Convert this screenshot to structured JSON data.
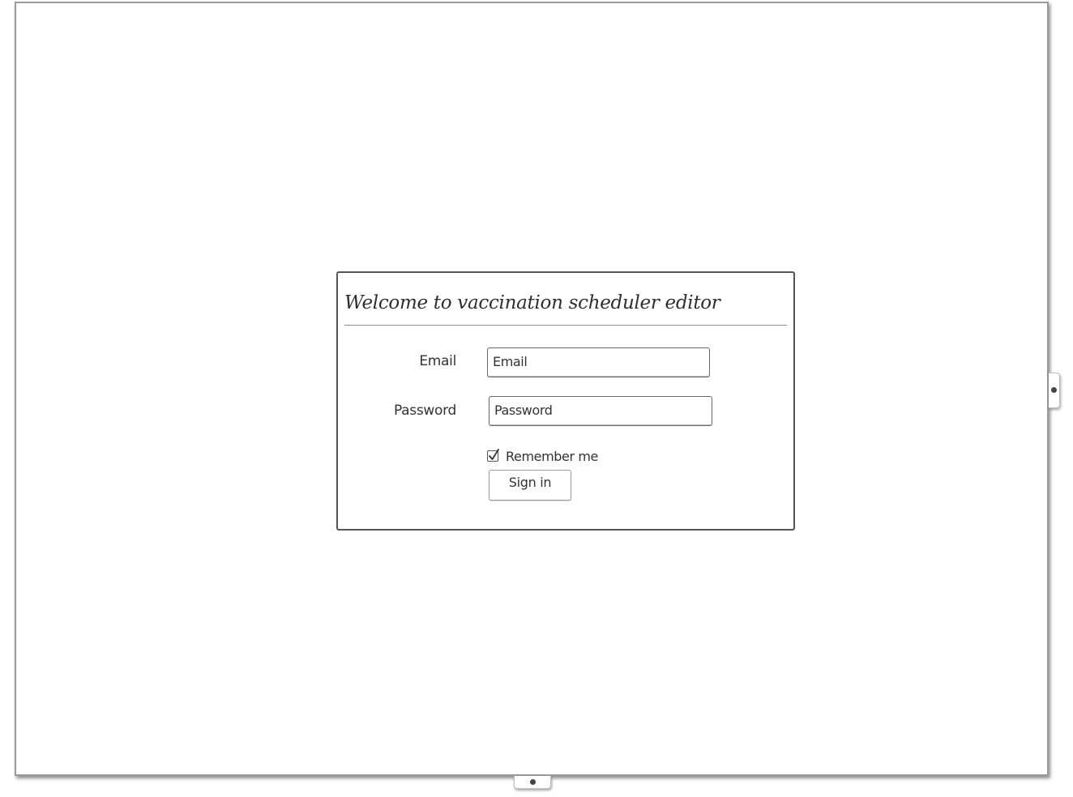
{
  "dialog": {
    "title": "Welcome to vaccination scheduler editor",
    "email_label": "Email",
    "email_value": "Email",
    "password_label": "Password",
    "password_value": "Password",
    "remember_label": "Remember me",
    "remember_checked": true,
    "signin_label": "Sign in"
  }
}
